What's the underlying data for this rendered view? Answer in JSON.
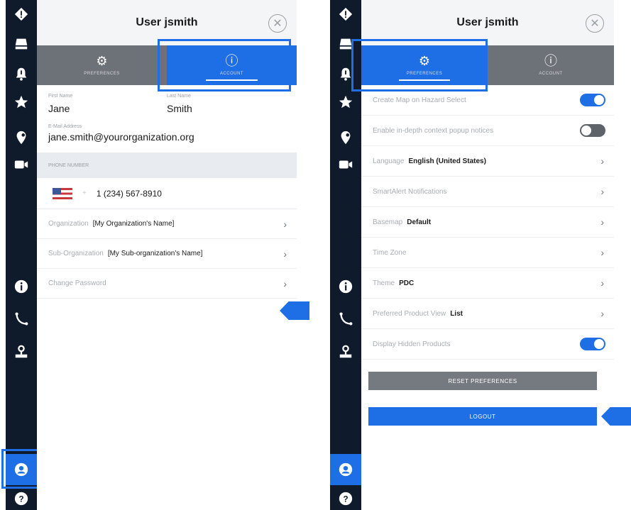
{
  "left": {
    "header": {
      "title": "User jsmith"
    },
    "tabs": [
      {
        "label": "PREFERENCES",
        "icon": "gear-icon"
      },
      {
        "label": "ACCOUNT",
        "icon": "info-icon"
      }
    ],
    "first_name": {
      "label": "First Name",
      "value": "Jane"
    },
    "last_name": {
      "label": "Last Name",
      "value": "Smith"
    },
    "email": {
      "label": "E-Mail Address",
      "value": "jane.smith@yourorganization.org"
    },
    "phone_section": {
      "label": "PHONE NUMBER"
    },
    "phone": {
      "value": "1 (234) 567-8910",
      "separator": "+"
    },
    "organization": {
      "label": "Organization",
      "value": "[My Organization's Name]"
    },
    "sub_organization": {
      "label": "Sub-Organization",
      "value": "[My Sub-organization's Name]"
    },
    "change_password": {
      "label": "Change Password"
    }
  },
  "right": {
    "header": {
      "title": "User jsmith"
    },
    "tabs": [
      {
        "label": "PREFERENCES",
        "icon": "gear-icon"
      },
      {
        "label": "ACCOUNT",
        "icon": "info-icon"
      }
    ],
    "settings": [
      {
        "label": "Create Map on Hazard Select",
        "value": "",
        "control": "toggle",
        "state": "on"
      },
      {
        "label": "Enable in-depth context popup notices",
        "value": "",
        "control": "toggle",
        "state": "off"
      },
      {
        "label": "Language",
        "value": "English (United States)",
        "control": "chevron"
      },
      {
        "label": "SmartAlert Notifications",
        "value": "",
        "control": "chevron"
      },
      {
        "label": "Basemap",
        "value": "Default",
        "control": "chevron"
      },
      {
        "label": "Time Zone",
        "value": "",
        "control": "chevron"
      },
      {
        "label": "Theme",
        "value": "PDC",
        "control": "chevron"
      },
      {
        "label": "Preferred Product View",
        "value": "List",
        "control": "chevron"
      },
      {
        "label": "Display Hidden Products",
        "value": "",
        "control": "toggle",
        "state": "on"
      }
    ],
    "reset_button": "RESET PREFERENCES",
    "logout_button": "LOGOUT"
  },
  "rail_icons": [
    "hazard-icon",
    "layers-icon",
    "alert-bell-icon",
    "star-icon",
    "location-icon",
    "video-icon",
    "info-icon",
    "phone-icon",
    "map-pin-icon",
    "user-icon",
    "help-icon"
  ],
  "colors": {
    "accent": "#1e6fe6",
    "rail": "#0f1a2b",
    "tabs": "#6d7278"
  }
}
